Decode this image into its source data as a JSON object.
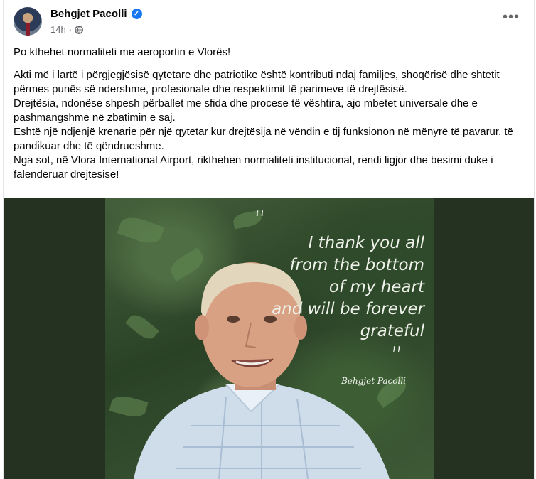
{
  "post": {
    "author": "Behgjet Pacolli",
    "time": "14h",
    "dot": "·",
    "more_label": "•••",
    "headline": "Po kthehet normaliteti me aeroportin e Vlorës!",
    "body": [
      "Akti më i lartë i përgjegjësisë qytetare dhe patriotike është kontributi ndaj familjes, shoqërisë dhe shtetit përmes punës së ndershme, profesionale dhe respektimit të parimeve të drejtësisë.",
      "Drejtësia, ndonëse shpesh përballet me sfida dhe procese të vështira, ajo mbetet universale dhe e pashmangshme në zbatimin e saj.",
      "Eshtë një ndjenjë krenarie për një qytetar  kur drejtësija në vëndin e tij funksionon në mënyrë të pavarur, të pandikuar dhe të qëndrueshme.",
      "Nga sot, në Vlora International Airport, rikthehen normaliteti institucional, rendi ligjor dhe besimi duke i falenderuar drejtesise!"
    ]
  },
  "image": {
    "quote_open": "“",
    "quote_lines": [
      "I thank you all",
      "from the bottom",
      "of my heart",
      "and will be forever",
      "grateful"
    ],
    "quote_close": "”",
    "signature": "Behgjet Pacolli"
  },
  "icons": {
    "verified": "verified-badge-icon",
    "audience": "globe-icon",
    "more": "more-options-icon"
  },
  "colors": {
    "accent": "#1877f2",
    "secondary_text": "#65676b",
    "photo_background": "#253222"
  }
}
